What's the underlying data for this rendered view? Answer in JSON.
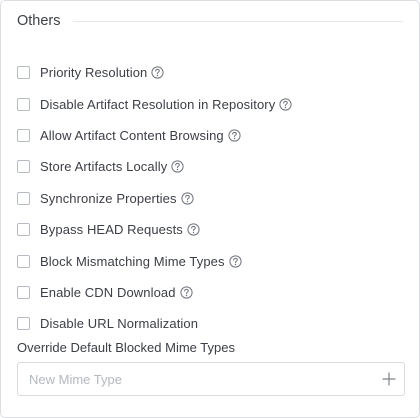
{
  "section": {
    "title": "Others"
  },
  "options": [
    {
      "label": "Priority Resolution",
      "checked": false,
      "help": true
    },
    {
      "label": "Disable Artifact Resolution in Repository",
      "checked": false,
      "help": true
    },
    {
      "label": "Allow Artifact Content Browsing",
      "checked": false,
      "help": true
    },
    {
      "label": "Store Artifacts Locally",
      "checked": false,
      "help": true
    },
    {
      "label": "Synchronize Properties",
      "checked": false,
      "help": true
    },
    {
      "label": "Bypass HEAD Requests",
      "checked": false,
      "help": true
    },
    {
      "label": "Block Mismatching Mime Types",
      "checked": false,
      "help": true
    },
    {
      "label": "Enable CDN Download",
      "checked": false,
      "help": true
    },
    {
      "label": "Disable URL Normalization",
      "checked": false,
      "help": false
    }
  ],
  "mime_types": {
    "label": "Override Default Blocked Mime Types",
    "placeholder": "New Mime Type",
    "value": ""
  },
  "icons": {
    "help": "question-circle-icon",
    "add": "plus-icon"
  },
  "colors": {
    "border": "#dcdee3",
    "text": "#3b3f45",
    "checkbox_border": "#b7bcc4",
    "placeholder": "#b4b8bf",
    "icon": "#7d828a"
  }
}
